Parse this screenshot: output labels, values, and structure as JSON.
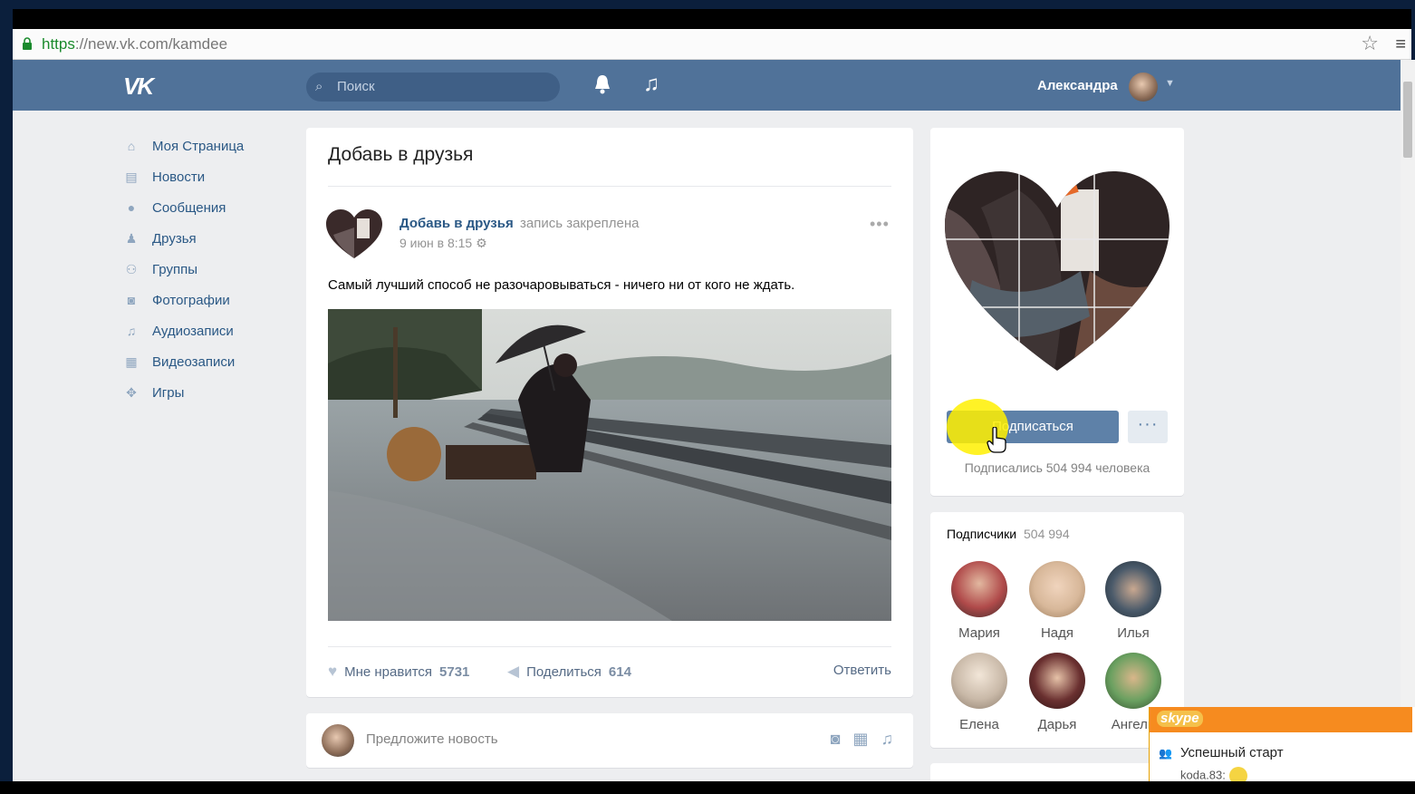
{
  "browser": {
    "url_scheme": "https",
    "url_rest": "://new.vk.com/kamdee",
    "star_icon": "star-icon",
    "menu_icon": "hamburger-icon"
  },
  "header": {
    "logo": "VK",
    "search_placeholder": "Поиск",
    "user_name": "Александра"
  },
  "nav": {
    "items": [
      {
        "label": "Моя Страница",
        "icon": "home-icon"
      },
      {
        "label": "Новости",
        "icon": "news-icon"
      },
      {
        "label": "Сообщения",
        "icon": "messages-icon"
      },
      {
        "label": "Друзья",
        "icon": "friend-icon"
      },
      {
        "label": "Группы",
        "icon": "groups-icon"
      },
      {
        "label": "Фотографии",
        "icon": "camera-icon"
      },
      {
        "label": "Аудиозаписи",
        "icon": "music-icon"
      },
      {
        "label": "Видеозаписи",
        "icon": "film-icon"
      },
      {
        "label": "Игры",
        "icon": "gamepad-icon"
      }
    ]
  },
  "wall": {
    "title": "Добавь в друзья",
    "post": {
      "author": "Добавь в друзья",
      "pinned": "запись закреплена",
      "date": "9 июн в 8:15",
      "text": "Самый лучший способ не разочаровываться - ничего ни от кого не ждать.",
      "like_label": "Мне нравится",
      "like_count": "5731",
      "share_label": "Поделиться",
      "share_count": "614",
      "reply_label": "Ответить"
    }
  },
  "suggest": {
    "placeholder": "Предложите новость"
  },
  "profile": {
    "subscribe_label": "Подписаться",
    "subscribers_text": "Подписались 504 994 человека"
  },
  "followers": {
    "title": "Подписчики",
    "count": "504 994",
    "people": [
      {
        "name": "Мария",
        "color": "#b04a4a"
      },
      {
        "name": "Надя",
        "color": "#d8b89a"
      },
      {
        "name": "Илья",
        "color": "#4a5a6a"
      },
      {
        "name": "Елена",
        "color": "#c9b9a8"
      },
      {
        "name": "Дарья",
        "color": "#6a3030"
      },
      {
        "name": "Ангели",
        "color": "#6aa060"
      }
    ]
  },
  "skype": {
    "brand": "skype",
    "chat_title": "Успешный старт",
    "message": "koda.83:"
  },
  "colors": {
    "vk_header": "#507299",
    "link": "#2a5885",
    "page_bg": "#edeef0",
    "skype_orange": "#f68b1f"
  }
}
